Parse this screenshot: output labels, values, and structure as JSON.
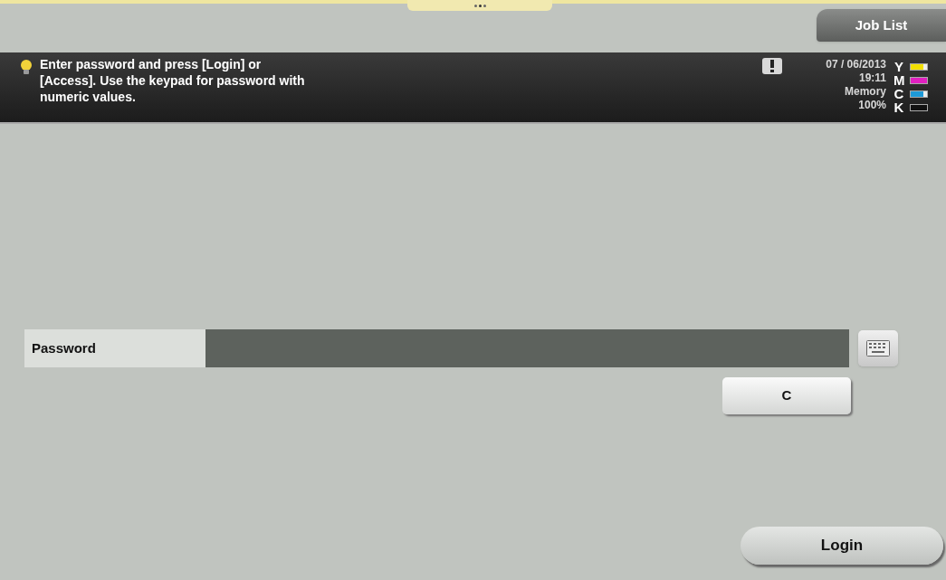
{
  "header": {
    "job_list_button": "Job List"
  },
  "message_bar": {
    "message": "Enter password and press [Login] or [Access]. Use the keypad for password with numeric values.",
    "date": "07 / 06/2013",
    "time": "19:11",
    "memory_label": "Memory",
    "memory_value": "100%",
    "toners": [
      {
        "letter": "Y",
        "color": "#f2e000",
        "level": 0.75
      },
      {
        "letter": "M",
        "color": "#e020c0",
        "level": 1
      },
      {
        "letter": "C",
        "color": "#1e9ad8",
        "level": 0.75
      },
      {
        "letter": "K",
        "color": "#111111",
        "level": 1
      }
    ]
  },
  "password": {
    "label": "Password"
  },
  "clear_button": "C",
  "login_button": "Login"
}
